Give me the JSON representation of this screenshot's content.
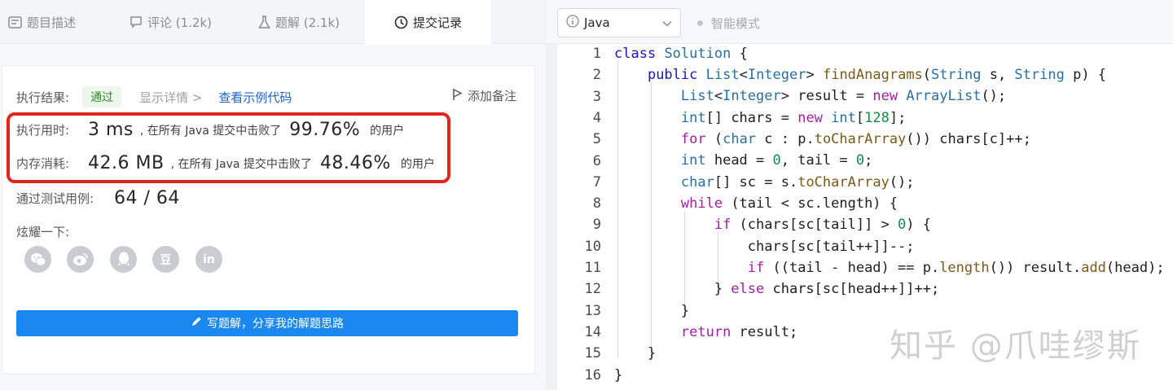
{
  "tabs": [
    {
      "label": "题目描述",
      "icon": "description-icon"
    },
    {
      "label": "评论 (1.2k)",
      "icon": "comment-icon"
    },
    {
      "label": "题解 (2.1k)",
      "icon": "flask-icon"
    },
    {
      "label": "提交记录",
      "icon": "clock-icon",
      "active": true
    }
  ],
  "result": {
    "label": "执行结果:",
    "status": "通过",
    "details_link": "显示详情 >",
    "example_link": "查看示例代码",
    "add_note": "添加备注"
  },
  "runtime": {
    "label": "执行用时:",
    "value": "3 ms",
    "prefix": ", 在所有 Java 提交中击败了",
    "percent": "99.76%",
    "suffix": "的用户"
  },
  "memory": {
    "label": "内存消耗:",
    "value": "42.6 MB",
    "prefix": ", 在所有 Java 提交中击败了",
    "percent": "48.46%",
    "suffix": "的用户"
  },
  "tests": {
    "label": "通过测试用例:",
    "value": "64 / 64"
  },
  "share": {
    "label": "炫耀一下:",
    "icons": [
      "wechat-icon",
      "weibo-icon",
      "qq-icon",
      "douban-icon",
      "linkedin-icon"
    ],
    "douban_text": "豆",
    "linkedin_text": "in"
  },
  "write_button": "写题解，分享我的解题思路",
  "editor": {
    "language": "Java",
    "mode": "智能模式",
    "line_numbers": [
      "1",
      "2",
      "3",
      "4",
      "5",
      "6",
      "7",
      "8",
      "9",
      "10",
      "11",
      "12",
      "13",
      "14",
      "15",
      "16"
    ]
  },
  "watermark": "知乎 @爪哇缪斯",
  "colors": {
    "accent": "#1a88f0",
    "pass": "#2d8a2d",
    "highlight": "#e0261f",
    "link": "#1f63c7"
  }
}
